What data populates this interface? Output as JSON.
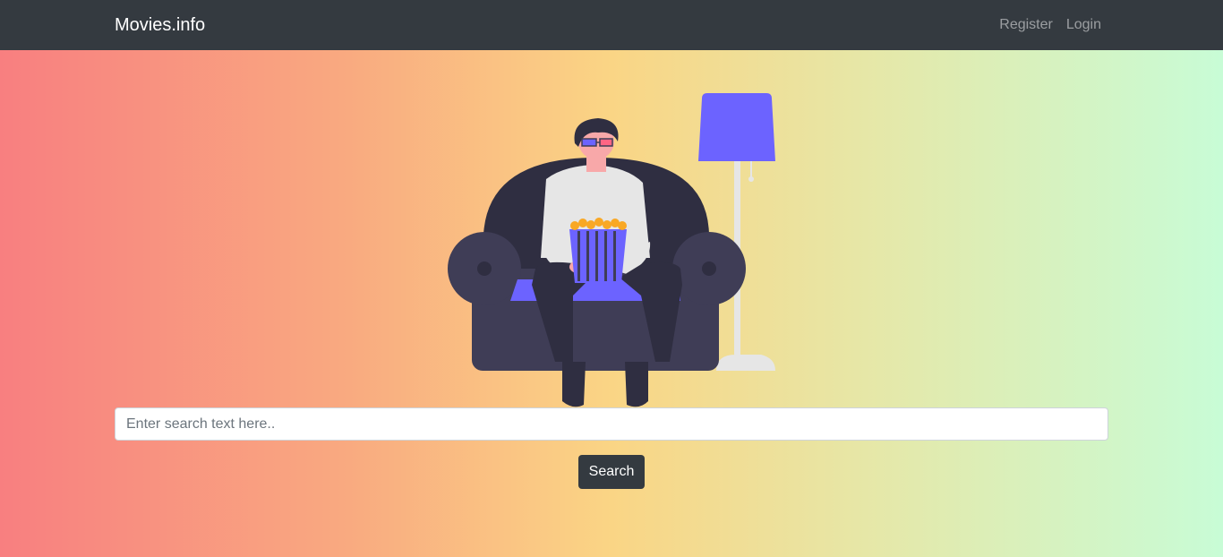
{
  "navbar": {
    "brand": "Movies.info",
    "links": [
      {
        "label": "Register"
      },
      {
        "label": "Login"
      }
    ]
  },
  "search": {
    "placeholder": "Enter search text here..",
    "value": "",
    "button_label": "Search"
  },
  "illustration": {
    "icon": "person-on-couch-with-popcorn-illustration",
    "colors": {
      "couch": "#3f3d56",
      "lamp_shade": "#6c63ff",
      "lamp_stand": "#e6e6e6",
      "popcorn": "#f9a825"
    }
  },
  "colors": {
    "navbar": "#343a40",
    "gradient_start": "#f87f80",
    "gradient_middle": "#fad585",
    "gradient_end": "#c8fcd6",
    "button": "#343a40"
  }
}
